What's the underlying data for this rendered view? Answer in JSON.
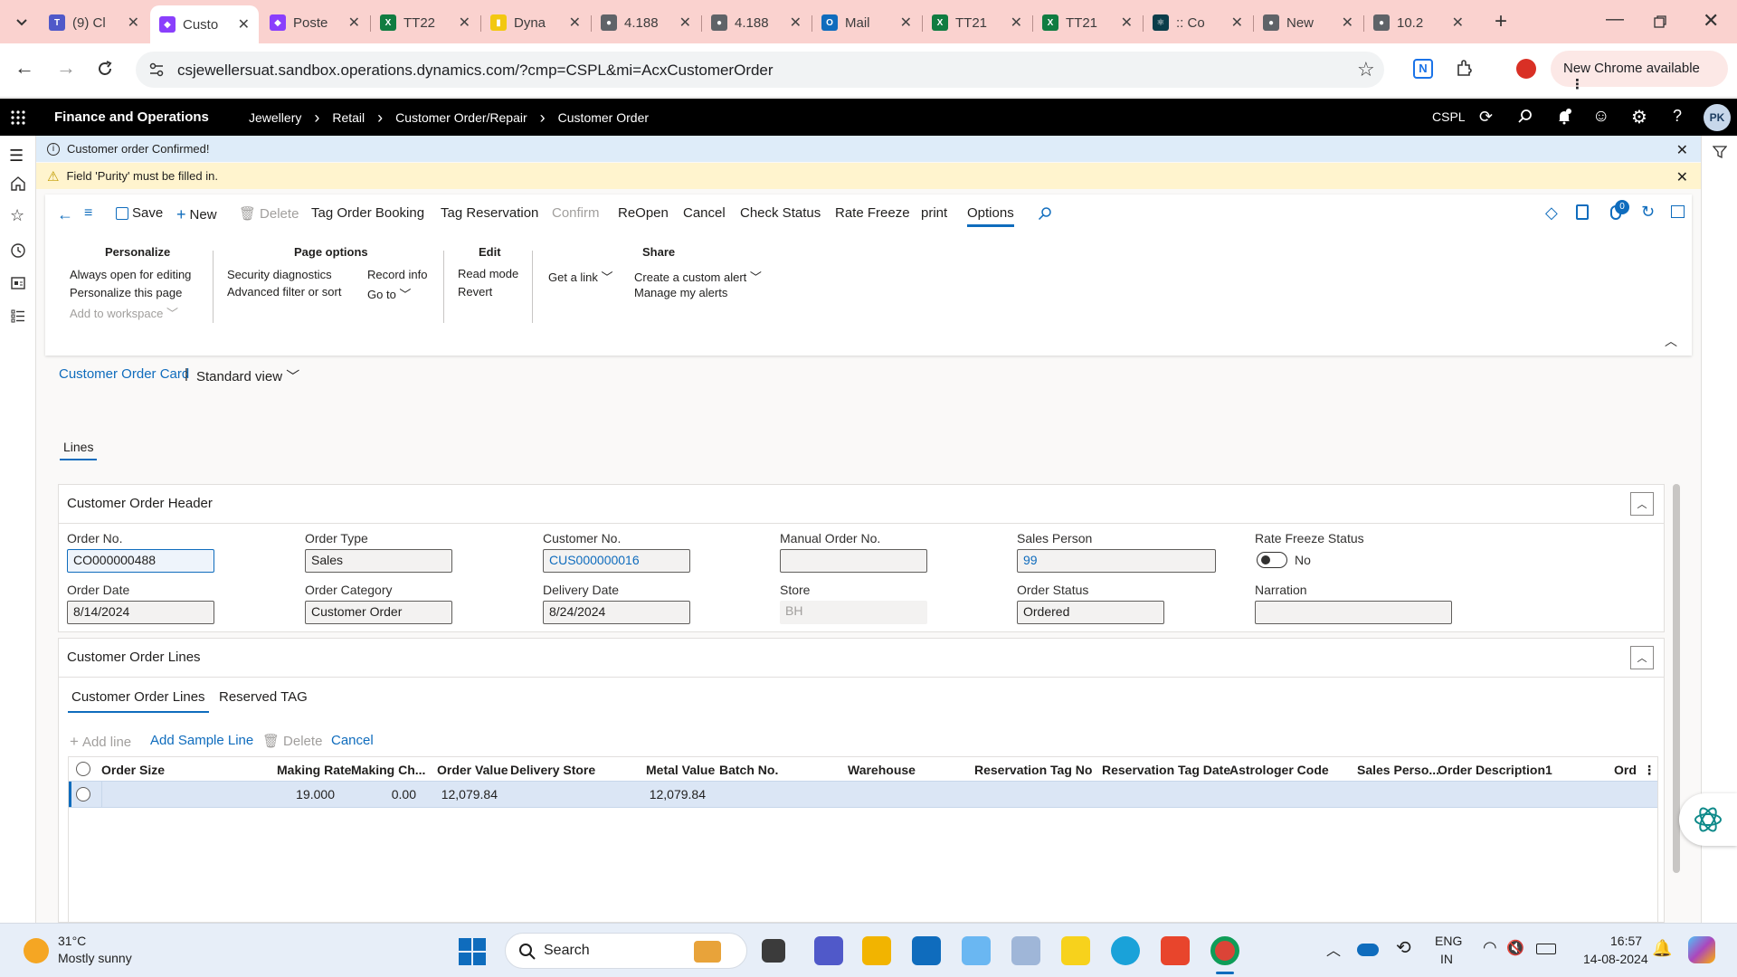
{
  "browser": {
    "tabs": [
      {
        "label": "(9) Cl",
        "color": "#5059c9",
        "glyph": "T"
      },
      {
        "label": "Custo",
        "color": "#8a3ffc",
        "glyph": "◆",
        "active": true
      },
      {
        "label": "Poste",
        "color": "#8a3ffc",
        "glyph": "◆"
      },
      {
        "label": "TT22",
        "color": "#107c41",
        "glyph": "X"
      },
      {
        "label": "Dyna",
        "color": "#f2c811",
        "glyph": "▮"
      },
      {
        "label": "4.188",
        "color": "#5f6368",
        "glyph": "●"
      },
      {
        "label": "4.188",
        "color": "#5f6368",
        "glyph": "●"
      },
      {
        "label": "Mail",
        "color": "#0f6cbd",
        "glyph": "O"
      },
      {
        "label": "TT21",
        "color": "#107c41",
        "glyph": "X"
      },
      {
        "label": "TT21",
        "color": "#107c41",
        "glyph": "X"
      },
      {
        "label": ":: Co",
        "color": "#0b3d4a",
        "glyph": "⚛"
      },
      {
        "label": "New",
        "color": "#5f6368",
        "glyph": "●"
      },
      {
        "label": "10.2",
        "color": "#5f6368",
        "glyph": "●"
      }
    ],
    "url": "csjewellersuat.sandbox.operations.dynamics.com/?cmp=CSPL&mi=AcxCustomerOrder",
    "chrome_notice": "New Chrome available"
  },
  "app": {
    "brand": "Finance and Operations",
    "breadcrumbs": [
      "Jewellery",
      "Retail",
      "Customer Order/Repair",
      "Customer Order"
    ],
    "company": "CSPL",
    "user_initials": "PK"
  },
  "messages": {
    "info": "Customer order Confirmed!",
    "warning": "Field 'Purity' must be filled in."
  },
  "actions": {
    "save": "Save",
    "new": "New",
    "delete": "Delete",
    "tag_order_booking": "Tag Order Booking",
    "tag_reservation": "Tag Reservation",
    "confirm": "Confirm",
    "reopen": "ReOpen",
    "cancel": "Cancel",
    "check_status": "Check Status",
    "rate_freeze": "Rate Freeze",
    "print": "print",
    "options": "Options",
    "badge_count": "0"
  },
  "options_pane": {
    "personalize": {
      "title": "Personalize",
      "items": [
        "Always open for editing",
        "Personalize this page",
        "Add to workspace"
      ]
    },
    "page_options": {
      "title": "Page options",
      "items": [
        "Security diagnostics",
        "Advanced filter or sort",
        "Record info",
        "Go to"
      ]
    },
    "edit": {
      "title": "Edit",
      "items": [
        "Read mode",
        "Revert"
      ]
    },
    "share": {
      "title": "Share",
      "items": [
        "Get a link",
        "Create a custom alert",
        "Manage my alerts"
      ]
    }
  },
  "page": {
    "card_title": "Customer Order Card",
    "separator": "|",
    "view": "Standard view",
    "tab_lines": "Lines"
  },
  "header_section": {
    "title": "Customer Order Header",
    "fields": {
      "order_no": {
        "label": "Order No.",
        "value": "CO000000488"
      },
      "order_type": {
        "label": "Order Type",
        "value": "Sales"
      },
      "customer_no": {
        "label": "Customer No.",
        "value": "CUS000000016"
      },
      "manual_order_no": {
        "label": "Manual Order No.",
        "value": ""
      },
      "sales_person": {
        "label": "Sales Person",
        "value": "99"
      },
      "rate_freeze_status": {
        "label": "Rate Freeze Status",
        "value": "No"
      },
      "order_date": {
        "label": "Order Date",
        "value": "8/14/2024"
      },
      "order_category": {
        "label": "Order Category",
        "value": "Customer Order"
      },
      "delivery_date": {
        "label": "Delivery Date",
        "value": "8/24/2024"
      },
      "store": {
        "label": "Store",
        "value": "BH"
      },
      "order_status": {
        "label": "Order Status",
        "value": "Ordered"
      },
      "narration": {
        "label": "Narration",
        "value": ""
      }
    }
  },
  "lines_section": {
    "title": "Customer Order Lines",
    "tabs": [
      "Customer Order Lines",
      "Reserved TAG"
    ],
    "buttons": {
      "add_line": "Add line",
      "add_sample_line": "Add Sample Line",
      "delete": "Delete",
      "cancel": "Cancel"
    },
    "columns": [
      "Order Size",
      "Making Rate",
      "Making Ch...",
      "Order Value",
      "Delivery Store",
      "Metal Value",
      "Batch No.",
      "Warehouse",
      "Reservation Tag No",
      "Reservation Tag Date",
      "Astrologer Code",
      "Sales Perso...",
      "Order Description1",
      "Ord"
    ],
    "rows": [
      {
        "order_size": "",
        "making_rate": "19.000",
        "making_charge": "0.00",
        "order_value": "12,079.84",
        "delivery_store": "",
        "metal_value": "12,079.84"
      }
    ]
  },
  "taskbar": {
    "weather_temp": "31°C",
    "weather_desc": "Mostly sunny",
    "search": "Search",
    "lang": "ENG",
    "region": "IN",
    "time": "16:57",
    "date": "14-08-2024"
  }
}
